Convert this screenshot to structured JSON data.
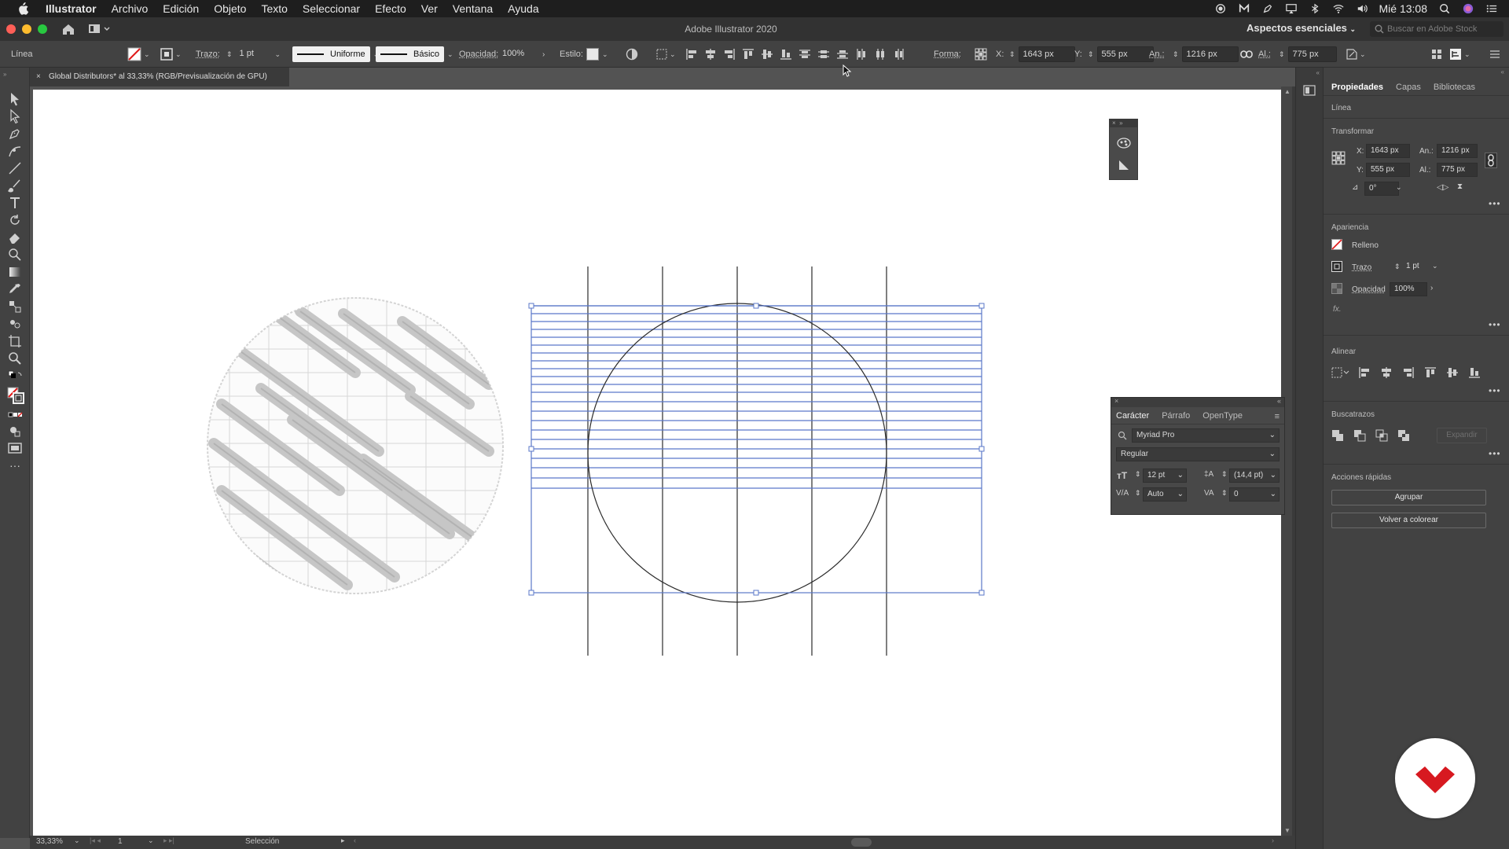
{
  "menubar": {
    "app": "Illustrator",
    "items": [
      "Archivo",
      "Edición",
      "Objeto",
      "Texto",
      "Seleccionar",
      "Efecto",
      "Ver",
      "Ventana",
      "Ayuda"
    ],
    "clock": "Mié 13:08"
  },
  "titlebar": {
    "title": "Adobe Illustrator 2020",
    "workspace": "Aspectos esenciales",
    "stock_placeholder": "Buscar en Adobe Stock"
  },
  "controlbar": {
    "object_type": "Línea",
    "stroke_label": "Trazo:",
    "stroke_weight": "1 pt",
    "profile": "Uniforme",
    "brush": "Básico",
    "opacity_label": "Opacidad:",
    "opacity": "100%",
    "style_label": "Estilo:",
    "shape_label": "Forma:",
    "x_label": "X:",
    "x": "1643 px",
    "y_label": "Y:",
    "y": "555 px",
    "w_label": "An.:",
    "w": "1216 px",
    "h_label": "Al.:",
    "h": "775 px"
  },
  "document_tab": {
    "title": "Global Distributors* al 33,33% (RGB/Previsualización de GPU)"
  },
  "statusbar": {
    "zoom": "33,33%",
    "page": "1",
    "tool": "Selección"
  },
  "character_panel": {
    "tabs": [
      "Carácter",
      "Párrafo",
      "OpenType"
    ],
    "font": "Myriad Pro",
    "style": "Regular",
    "size": "12 pt",
    "leading": "(14,4 pt)",
    "kerning": "Auto",
    "tracking": "0"
  },
  "properties_panel": {
    "tabs": [
      "Propiedades",
      "Capas",
      "Bibliotecas"
    ],
    "object_type": "Línea",
    "transform_title": "Transformar",
    "x_label": "X:",
    "x": "1643 px",
    "y_label": "Y:",
    "y": "555 px",
    "w_label": "An.:",
    "w": "1216 px",
    "h_label": "Al.:",
    "h": "775 px",
    "angle": "0°",
    "appearance_title": "Apariencia",
    "fill_label": "Relleno",
    "stroke_label": "Trazo",
    "stroke_weight": "1 pt",
    "opacity_label": "Opacidad",
    "opacity": "100%",
    "fx": "fx.",
    "align_title": "Alinear",
    "pathfinder_title": "Buscatrazos",
    "expand": "Expandir",
    "quick_actions_title": "Acciones rápidas",
    "group_button": "Agrupar",
    "recolor_button": "Volver a colorear"
  },
  "colors": {
    "selection_blue": "#4f6fc7",
    "ui_dark": "#424242",
    "brand_red": "#d71920"
  }
}
